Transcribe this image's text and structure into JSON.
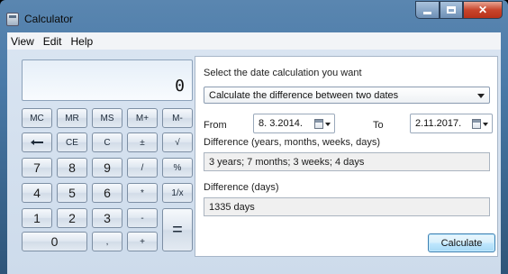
{
  "window": {
    "title": "Calculator"
  },
  "menu": [
    "View",
    "Edit",
    "Help"
  ],
  "display": {
    "value": "0"
  },
  "keys": {
    "mc": "MC",
    "mr": "MR",
    "ms": "MS",
    "mplus": "M+",
    "mminus": "M-",
    "ce": "CE",
    "c": "C",
    "plusminus": "±",
    "sqrt": "√",
    "n7": "7",
    "n8": "8",
    "n9": "9",
    "div": "/",
    "pct": "%",
    "n4": "4",
    "n5": "5",
    "n6": "6",
    "mul": "*",
    "recip": "1/x",
    "n1": "1",
    "n2": "2",
    "n3": "3",
    "sub": "-",
    "eq": "=",
    "n0": "0",
    "dot": ",",
    "add": "+"
  },
  "date_panel": {
    "prompt": "Select the date calculation you want",
    "mode": "Calculate the difference between two dates",
    "from_label": "From",
    "from_date": "8. 3.2014.",
    "to_label": "To",
    "to_date": "2.11.2017.",
    "diff_label": "Difference (years, months, weeks, days)",
    "diff_value": "3 years; 7 months; 3 weeks; 4 days",
    "days_label": "Difference (days)",
    "days_value": "1335 days",
    "calculate": "Calculate"
  }
}
